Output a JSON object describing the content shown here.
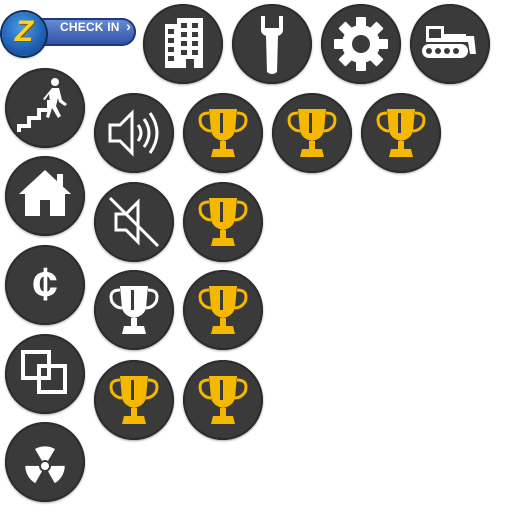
{
  "checkin": {
    "badge_letter": "Z",
    "label": "CHECK IN",
    "chevron": "›",
    "badge_color": "#1f5fb3",
    "letter_color": "#ffd21f",
    "pill_color": "#2d4fa0"
  },
  "icon_style": {
    "circle_color": "#3a3a3a",
    "glyph_color": "#ffffff",
    "trophy_gold": "#f5b800",
    "trophy_silver": "#ffffff"
  },
  "icons": [
    {
      "name": "buildings-icon"
    },
    {
      "name": "wrench-icon"
    },
    {
      "name": "gear-icon"
    },
    {
      "name": "bulldozer-icon"
    },
    {
      "name": "stairs-exit-icon"
    },
    {
      "name": "sound-on-icon"
    },
    {
      "name": "trophy-gold-icon"
    },
    {
      "name": "trophy-gold-icon"
    },
    {
      "name": "trophy-gold-icon"
    },
    {
      "name": "home-icon"
    },
    {
      "name": "sound-muted-icon"
    },
    {
      "name": "trophy-gold-icon"
    },
    {
      "name": "cent-icon"
    },
    {
      "name": "trophy-silver-icon"
    },
    {
      "name": "trophy-gold-icon"
    },
    {
      "name": "overlapping-windows-icon"
    },
    {
      "name": "trophy-gold-icon"
    },
    {
      "name": "trophy-gold-icon"
    },
    {
      "name": "radiation-icon"
    }
  ],
  "cent_glyph": "¢"
}
